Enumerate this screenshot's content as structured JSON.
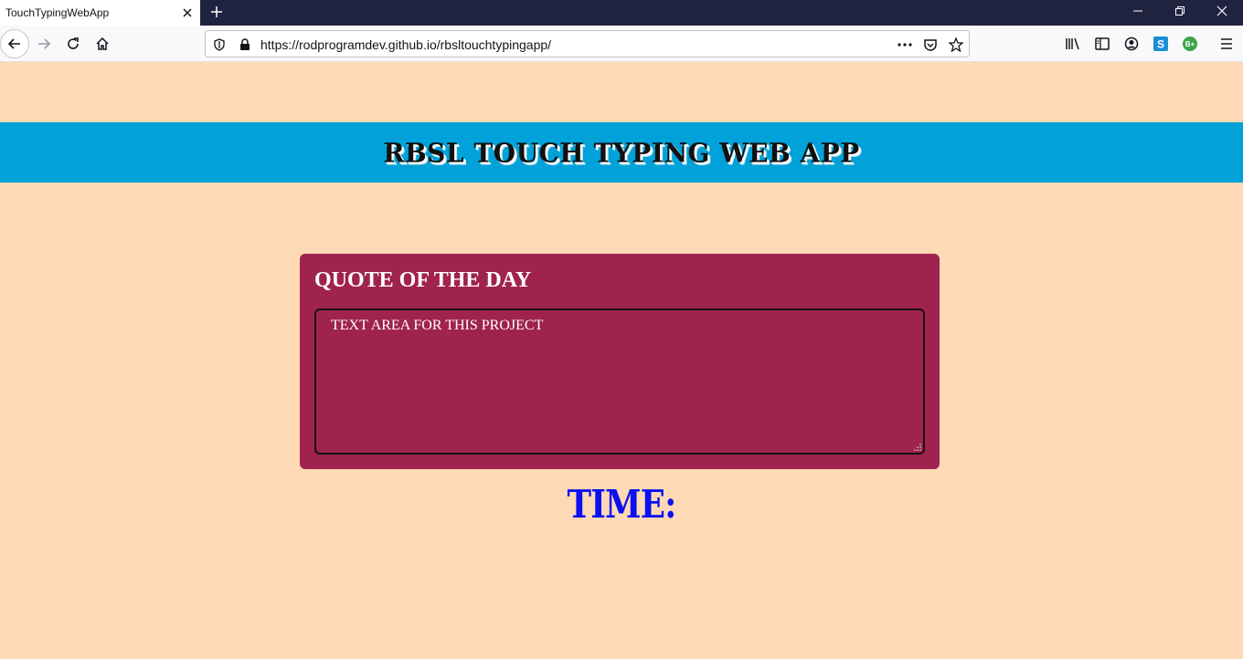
{
  "browser": {
    "tab_title": "TouchTypingWebApp",
    "url": "https://rodprogramdev.github.io/rbsltouchtypingapp/",
    "icons": {
      "back": "back-arrow-icon",
      "forward": "forward-arrow-icon",
      "reload": "reload-icon",
      "home": "home-icon",
      "shield": "tracking-shield-icon",
      "lock": "lock-icon",
      "more": "more-actions-icon",
      "pocket": "pocket-icon",
      "star": "bookmark-star-icon",
      "library": "library-icon",
      "sidebar": "sidebar-icon",
      "account": "account-icon",
      "ext_s": "extension-s-icon",
      "ext_b": "extension-b-icon",
      "menu": "hamburger-menu-icon"
    },
    "extension_b_label": "B+",
    "extension_s_label": "S"
  },
  "page": {
    "header_title": "RBSL TOUCH TYPING WEB APP",
    "quote_heading": "QUOTE OF THE DAY",
    "textarea_value": "TEXT AREA FOR THIS PROJECT",
    "timer_label": "TIME:"
  },
  "colors": {
    "page_background": "#fdd9b5",
    "header_band": "#00a2d9",
    "quote_card": "#a0224e",
    "timer_text": "#0a10f0"
  }
}
